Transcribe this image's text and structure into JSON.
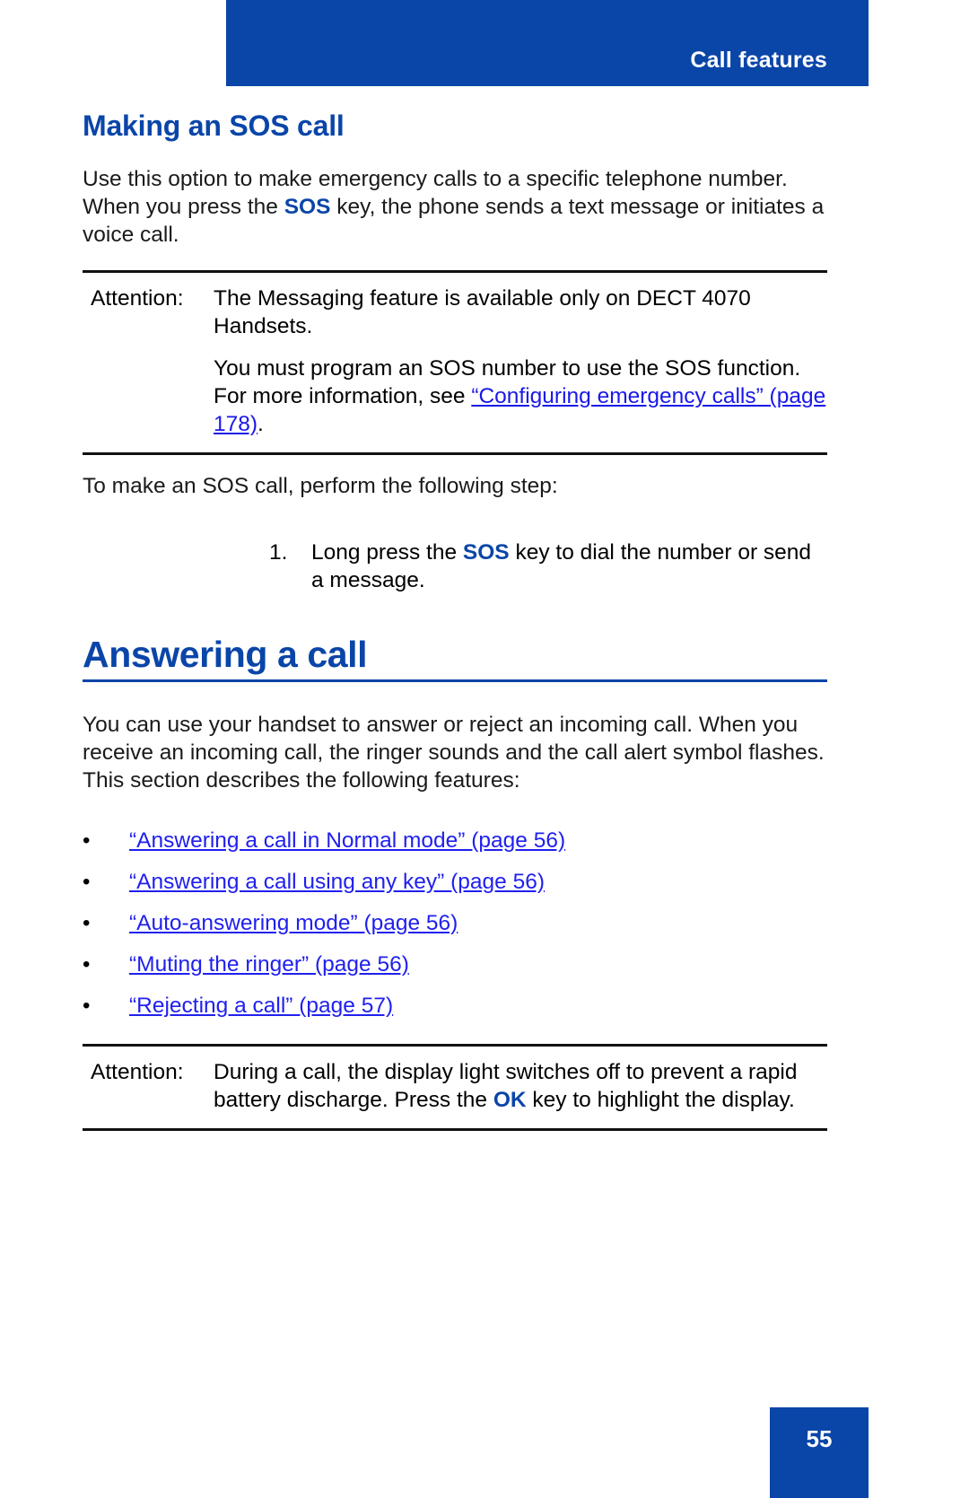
{
  "header": {
    "chapter_title": "Call features",
    "bar_color": "#0a45a8"
  },
  "section1": {
    "heading": "Making an SOS call",
    "intro_part1": "Use this option to make emergency calls to a specific telephone number. When you press the ",
    "intro_key": "SOS",
    "intro_part2": " key, the phone sends a text message or initiates a voice call.",
    "note": {
      "label": "Attention:",
      "paragraph1": "The Messaging feature is available only on DECT 4070 Handsets.",
      "paragraph2_lead": "You must program an SOS number to use the SOS function. For more information, see ",
      "paragraph2_link": "“Configuring emergency calls” (page 178)",
      "paragraph2_end": "."
    },
    "lead_in": "To make an SOS call, perform the following step:",
    "steps": [
      {
        "number": "1.",
        "text_part1": "Long press the ",
        "key": "SOS",
        "text_part2": " key to dial the number or send a message."
      }
    ]
  },
  "section2": {
    "heading": "Answering a call",
    "intro": "You can use your handset to answer or reject an incoming call. When you receive an incoming call, the ringer sounds and the call alert symbol flashes. This section describes the following features:",
    "bullet_marker": "•",
    "bullets": [
      "“Answering a call in Normal mode” (page 56)",
      "“Answering a call using any key” (page 56)",
      "“Auto-answering mode” (page 56)",
      "“Muting the ringer” (page 56)",
      "“Rejecting a call” (page 57)"
    ],
    "note": {
      "label": "Attention:",
      "text_part1": "During a call, the display light switches off to prevent a rapid battery discharge. Press the ",
      "key": "OK",
      "text_part2": " key to highlight the display."
    }
  },
  "footer": {
    "page_number": "55",
    "box_color": "#0a45a8"
  },
  "colors": {
    "brand_blue": "#0a45a8",
    "link_blue": "#1a18e8",
    "text_black": "#1a1a1a"
  }
}
